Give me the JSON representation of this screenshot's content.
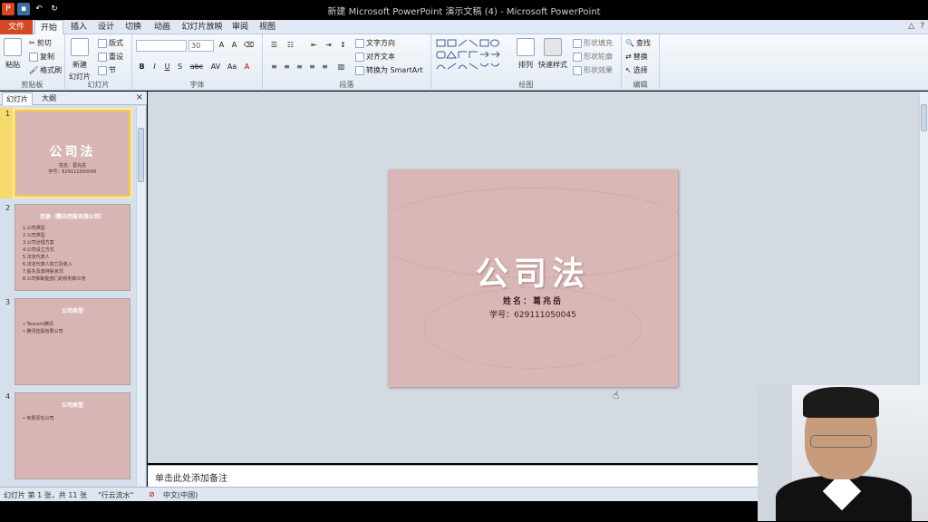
{
  "window": {
    "title": "新建 Microsoft PowerPoint 演示文稿 (4) - Microsoft PowerPoint"
  },
  "tabs": {
    "file": "文件",
    "items": [
      "开始",
      "插入",
      "设计",
      "切换",
      "动画",
      "幻灯片放映",
      "审阅",
      "视图"
    ],
    "active": "开始"
  },
  "ribbon": {
    "clipboard": {
      "title": "剪贴板",
      "paste": "粘贴",
      "cut": "剪切",
      "copy": "复制",
      "format_painter": "格式刷"
    },
    "slides": {
      "title": "幻灯片",
      "new_slide": "新建",
      "new_slide2": "幻灯片",
      "layout": "版式",
      "reset": "重设",
      "section": "节"
    },
    "font": {
      "title": "字体",
      "size": "30",
      "buttons": [
        "B",
        "I",
        "U",
        "S",
        "abc",
        "AV",
        "Aa",
        "A"
      ]
    },
    "paragraph": {
      "title": "段落",
      "text_direction": "文字方向",
      "align_text": "对齐文本",
      "convert_smartart": "转换为 SmartArt"
    },
    "drawing": {
      "title": "绘图",
      "arrange": "排列",
      "quick_styles": "快速样式",
      "shape_fill": "形状填充",
      "shape_outline": "形状轮廓",
      "shape_effects": "形状效果"
    },
    "editing": {
      "title": "编辑",
      "find": "查找",
      "replace": "替换",
      "select": "选择"
    }
  },
  "panel": {
    "tab_slides": "幻灯片",
    "tab_outline": "大纲",
    "close": "×"
  },
  "thumbnails": [
    {
      "num": "1",
      "title": "公司法",
      "lines": [
        "姓名：葛兆岳",
        "学号：629111050045"
      ]
    },
    {
      "num": "2",
      "title": "目录（腾讯控股有限公司）",
      "lines": [
        "1.公司类型",
        "2.公司类型",
        "3.公司治理方案",
        "4.公司设立方式",
        "5.法定代表人",
        "6.法定代表人权力及收入",
        "7.股东及其持股状况",
        "8.公司和职能部门的权利和义务"
      ]
    },
    {
      "num": "3",
      "title": "公司类型",
      "lines": [
        "• Tencent腾讯",
        "• 腾讯控股有限公司"
      ]
    },
    {
      "num": "4",
      "title": "公司类型",
      "lines": [
        "• 有限责任公司"
      ]
    }
  ],
  "slide": {
    "title": "公司法",
    "name": "姓名：葛兆岳",
    "student_id": "学号：629111050045"
  },
  "notes": {
    "placeholder": "单击此处添加备注"
  },
  "status": {
    "slide_pos": "幻灯片 第 1 张，共 11 张",
    "theme": "\"行云流水\"",
    "language": "中文(中国)"
  },
  "colors": {
    "file_tab": "#d24726",
    "slide_bg": "#dab7b7",
    "selection": "#f2c94c"
  }
}
